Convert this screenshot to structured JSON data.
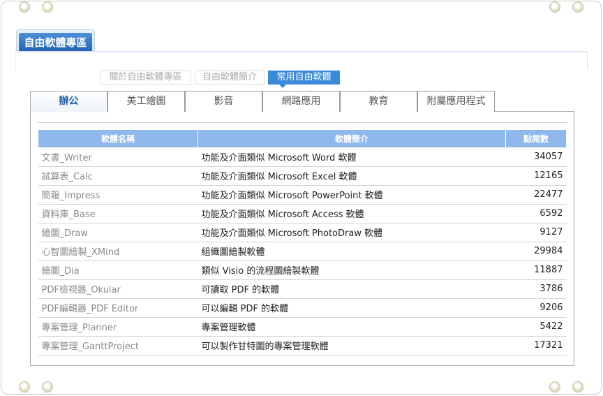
{
  "section_title": "自由軟體專區",
  "subnav": [
    "關於自由軟體專區",
    "自由軟體簡介",
    "常用自由軟體"
  ],
  "tabs": [
    "辦公",
    "美工繪圖",
    "影音",
    "網路應用",
    "教育",
    "附屬應用程式"
  ],
  "table": {
    "headers": [
      "軟體名稱",
      "軟體簡介",
      "點閱數"
    ],
    "rows": [
      {
        "name": "文書_Writer",
        "desc": "功能及介面類似 Microsoft Word 軟體",
        "hits": "34057"
      },
      {
        "name": "試算表_Calc",
        "desc": "功能及介面類似 Microsoft Excel 軟體",
        "hits": "12165"
      },
      {
        "name": "簡報_Impress",
        "desc": "功能及介面類似 Microsoft PowerPoint 軟體",
        "hits": "22477"
      },
      {
        "name": "資料庫_Base",
        "desc": "功能及介面類似 Microsoft Access 軟體",
        "hits": "6592"
      },
      {
        "name": "繪圖_Draw",
        "desc": "功能及介面類似 Microsoft PhotoDraw 軟體",
        "hits": "9127"
      },
      {
        "name": "心智圖繪製_XMind",
        "desc": "組織圖繪製軟體",
        "hits": "29984"
      },
      {
        "name": "繪圖_Dia",
        "desc": "類似 Visio 的流程圖繪製軟體",
        "hits": "11887"
      },
      {
        "name": "PDF檢視器_Okular",
        "desc": "可讀取 PDF 的軟體",
        "hits": "3786"
      },
      {
        "name": "PDF編輯器_PDF Editor",
        "desc": "可以編輯 PDF 的軟體",
        "hits": "9206"
      },
      {
        "name": "專案管理_Planner",
        "desc": "專案管理軟體",
        "hits": "5422"
      },
      {
        "name": "專案管理_GanttProject",
        "desc": "可以製作甘特圖的專案管理軟體",
        "hits": "17321"
      }
    ]
  }
}
